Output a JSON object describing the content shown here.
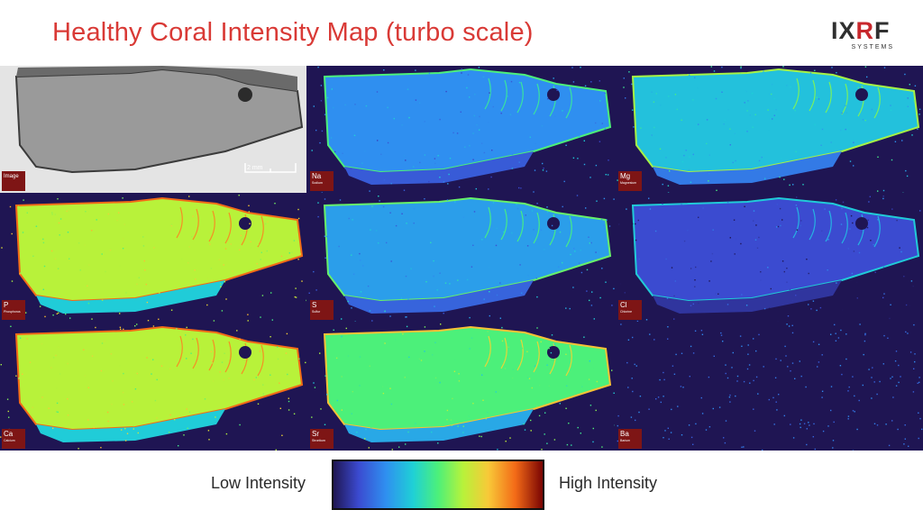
{
  "title": "Healthy Coral Intensity Map (turbo scale)",
  "logo": {
    "mark_left": "IX",
    "mark_x": "R",
    "mark_right": "F",
    "sub": "SYSTEMS"
  },
  "panels": [
    {
      "symbol": "Image",
      "name": "",
      "colormap": "gray"
    },
    {
      "symbol": "Na",
      "name": "Sodium",
      "colormap": "turbo",
      "level": 0.25
    },
    {
      "symbol": "Mg",
      "name": "Magnesium",
      "colormap": "turbo",
      "level": 0.35
    },
    {
      "symbol": "P",
      "name": "Phosphorus",
      "colormap": "turbo",
      "level": 0.62
    },
    {
      "symbol": "S",
      "name": "Sulfur",
      "colormap": "turbo",
      "level": 0.28
    },
    {
      "symbol": "Cl",
      "name": "Chlorine",
      "colormap": "turbo",
      "level": 0.12
    },
    {
      "symbol": "Ca",
      "name": "Calcium",
      "colormap": "turbo",
      "level": 0.62
    },
    {
      "symbol": "Sr",
      "name": "Strontium",
      "colormap": "turbo",
      "level": 0.5
    },
    {
      "symbol": "Ba",
      "name": "Barium",
      "colormap": "turbo",
      "level": 0.02
    }
  ],
  "scale_bar": "2 mm",
  "colorbar": {
    "low_label": "Low Intensity",
    "high_label": "High Intensity"
  },
  "colors": {
    "title": "#d93a36",
    "badge": "#7e1515",
    "background": "#1f1553"
  }
}
